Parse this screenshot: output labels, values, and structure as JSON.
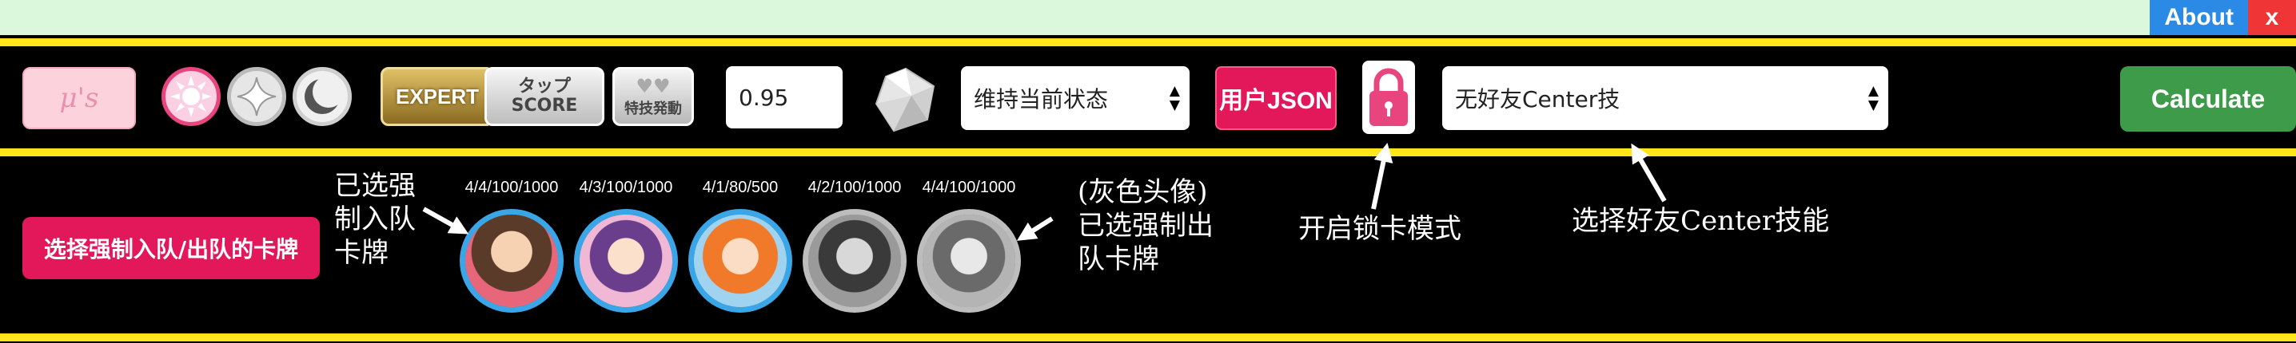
{
  "header": {
    "about_label": "About",
    "close_label": "x"
  },
  "toolbar": {
    "mu_label": "μ's",
    "attributes": [
      "smile",
      "pure",
      "cool"
    ],
    "difficulty_label": "EXPERT",
    "tap_score_line1": "タップ",
    "tap_score_line2": "SCORE",
    "skill_label": "特技発動",
    "value_input": "0.95",
    "status_select": "维持当前状态",
    "user_json_label": "用户JSON",
    "friend_center_select": "无好友Center技",
    "calculate_label": "Calculate"
  },
  "team": {
    "force_button_label": "选择强制入队/出队的卡牌",
    "slots": [
      {
        "label": "4/4/100/1000",
        "state": "forced-in"
      },
      {
        "label": "4/3/100/1000",
        "state": "forced-in"
      },
      {
        "label": "4/1/80/500",
        "state": "forced-in"
      },
      {
        "label": "4/2/100/1000",
        "state": "forced-out"
      },
      {
        "label": "4/4/100/1000",
        "state": "forced-out"
      }
    ]
  },
  "annotations": {
    "forced_in_line1": "已选强",
    "forced_in_line2": "制入队",
    "forced_in_line3": "卡牌",
    "forced_out_line1": "(灰色头像)",
    "forced_out_line2": "已选强制出",
    "forced_out_line3": "队卡牌",
    "lock_mode": "开启锁卡模式",
    "friend_center": "选择好友Center技能"
  },
  "colors": {
    "accent_pink": "#e2185a",
    "calculate_green": "#3e9b4a",
    "divider_yellow": "#ffe51a",
    "about_blue": "#2b8ae6",
    "close_red": "#ef3535"
  }
}
